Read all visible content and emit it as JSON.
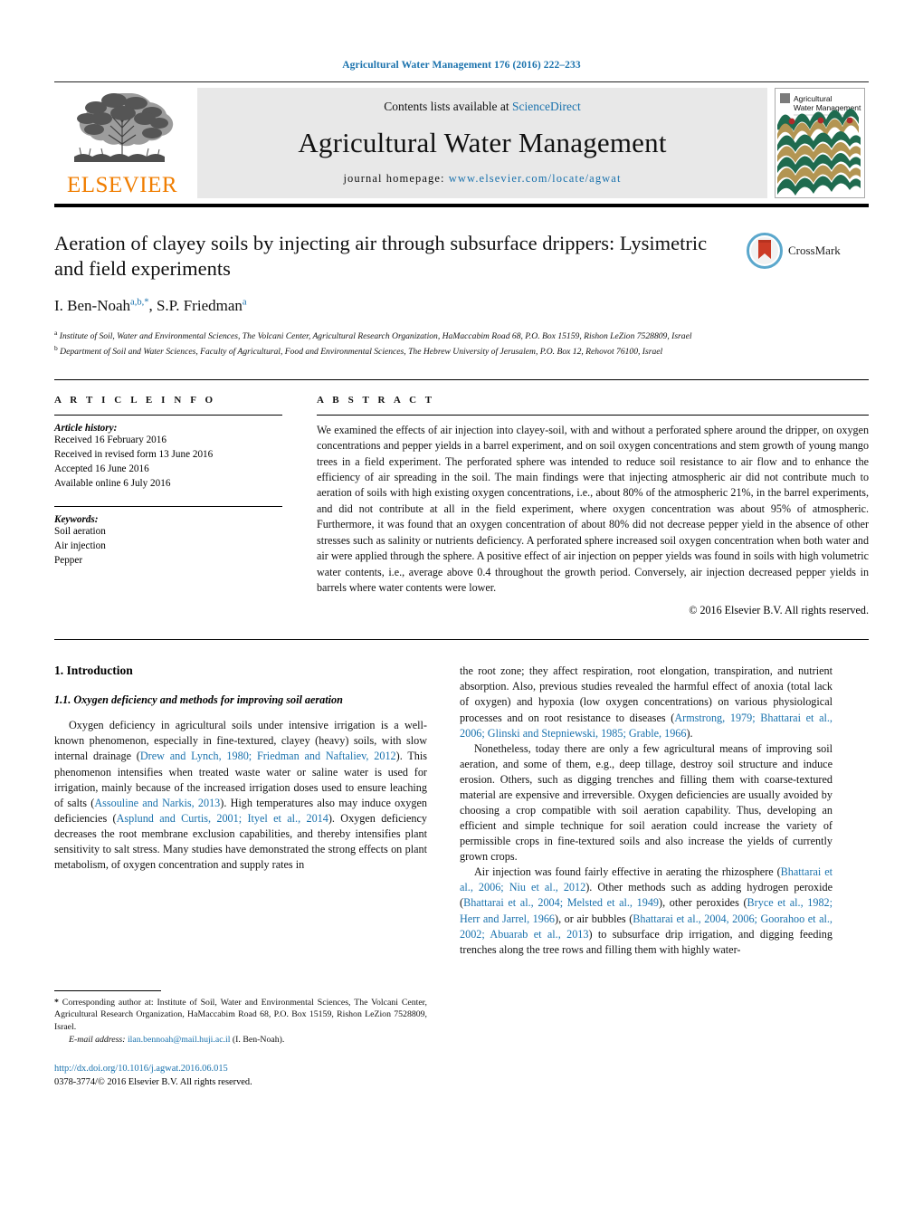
{
  "running_head": "Agricultural Water Management 176 (2016) 222–233",
  "banner": {
    "contents_prefix": "Contents lists available at ",
    "contents_link": "ScienceDirect",
    "journal_name": "Agricultural Water Management",
    "homepage_prefix": "journal homepage: ",
    "homepage_url": "www.elsevier.com/locate/agwat",
    "publisher": "ELSEVIER",
    "cover_title_line1": "Agricultural",
    "cover_title_line2": "Water Management"
  },
  "article": {
    "title": "Aeration of clayey soils by injecting air through subsurface drippers: Lysimetric and field experiments",
    "authors": [
      {
        "name": "I. Ben-Noah",
        "markers": "a,b,*"
      },
      {
        "name": "S.P. Friedman",
        "markers": "a"
      }
    ],
    "crossmark_label": "CrossMark",
    "affiliations": [
      {
        "marker": "a",
        "text": "Institute of Soil, Water and Environmental Sciences, The Volcani Center, Agricultural Research Organization, HaMaccabim Road 68, P.O. Box 15159, Rishon LeZion 7528809, Israel"
      },
      {
        "marker": "b",
        "text": "Department of Soil and Water Sciences, Faculty of Agricultural, Food and Environmental Sciences, The Hebrew University of Jerusalem, P.O. Box 12, Rehovot 76100, Israel"
      }
    ]
  },
  "article_info": {
    "heading": "A R T I C L E  I N F O",
    "history_label": "Article history:",
    "history": [
      "Received 16 February 2016",
      "Received in revised form 13 June 2016",
      "Accepted 16 June 2016",
      "Available online 6 July 2016"
    ],
    "keywords_label": "Keywords:",
    "keywords": [
      "Soil aeration",
      "Air injection",
      "Pepper"
    ]
  },
  "abstract": {
    "heading": "A B S T R A C T",
    "text": "We examined the effects of air injection into clayey-soil, with and without a perforated sphere around the dripper, on oxygen concentrations and pepper yields in a barrel experiment, and on soil oxygen concentrations and stem growth of young mango trees in a field experiment. The perforated sphere was intended to reduce soil resistance to air flow and to enhance the efficiency of air spreading in the soil. The main findings were that injecting atmospheric air did not contribute much to aeration of soils with high existing oxygen concentrations, i.e., about 80% of the atmospheric 21%, in the barrel experiments, and did not contribute at all in the field experiment, where oxygen concentration was about 95% of atmospheric. Furthermore, it was found that an oxygen concentration of about 80% did not decrease pepper yield in the absence of other stresses such as salinity or nutrients deficiency. A perforated sphere increased soil oxygen concentration when both water and air were applied through the sphere. A positive effect of air injection on pepper yields was found in soils with high volumetric water contents, i.e., average above 0.4 throughout the growth period. Conversely, air injection decreased pepper yields in barrels where water contents were lower.",
    "copyright": "© 2016 Elsevier B.V. All rights reserved."
  },
  "body": {
    "section_number_title": "1.  Introduction",
    "subsection_title": "1.1.  Oxygen deficiency and methods for improving soil aeration",
    "left_paragraph_1_a": "Oxygen deficiency in agricultural soils under intensive irrigation is a well-known phenomenon, especially in fine-textured, clayey (heavy) soils, with slow internal drainage (",
    "left_cite_1": "Drew and Lynch, 1980; Friedman and Naftaliev, 2012",
    "left_paragraph_1_b": "). This phenomenon intensifies when treated waste water or saline water is used for irrigation, mainly because of the increased irrigation doses used to ensure leaching of salts (",
    "left_cite_2": "Assouline and Narkis, 2013",
    "left_paragraph_1_c": "). High temperatures also may induce oxygen deficiencies (",
    "left_cite_3": "Asplund and Curtis, 2001; Ityel et al., 2014",
    "left_paragraph_1_d": "). Oxygen deficiency decreases the root membrane exclusion capabilities, and thereby intensifies plant sensitivity to salt stress. Many studies have demonstrated the strong effects on plant metabolism, of oxygen concentration and supply rates in",
    "right_paragraph_1_a": "the root zone; they affect respiration, root elongation, transpiration, and nutrient absorption. Also, previous studies revealed the harmful effect of anoxia (total lack of oxygen) and hypoxia (low oxygen concentrations) on various physiological processes and on root resistance to diseases (",
    "right_cite_1": "Armstrong, 1979; Bhattarai et al., 2006; Glinski and Stepniewski, 1985; Grable, 1966",
    "right_paragraph_1_b": ").",
    "right_paragraph_2": "Nonetheless, today there are only a few agricultural means of improving soil aeration, and some of them, e.g., deep tillage, destroy soil structure and induce erosion. Others, such as digging trenches and filling them with coarse-textured material are expensive and irreversible. Oxygen deficiencies are usually avoided by choosing a crop compatible with soil aeration capability. Thus, developing an efficient and simple technique for soil aeration could increase the variety of permissible crops in fine-textured soils and also increase the yields of currently grown crops.",
    "right_paragraph_3_a": "Air injection was found fairly effective in aerating the rhizosphere (",
    "right_cite_2": "Bhattarai et al., 2006; Niu et al., 2012",
    "right_paragraph_3_b": "). Other methods such as adding hydrogen peroxide (",
    "right_cite_3": "Bhattarai et al., 2004; Melsted et al., 1949",
    "right_paragraph_3_c": "), other peroxides (",
    "right_cite_4": "Bryce et al., 1982; Herr and Jarrel, 1966",
    "right_paragraph_3_d": "), or air bubbles (",
    "right_cite_5": "Bhattarai et al., 2004, 2006; Goorahoo et al., 2002; Abuarab et al., 2013",
    "right_paragraph_3_e": ") to subsurface drip irrigation, and digging feeding trenches along the tree rows and filling them with highly water-"
  },
  "footnote": {
    "star": "*",
    "corresponding": " Corresponding author at: Institute of Soil, Water and Environmental Sciences, The Volcani Center, Agricultural Research Organization, HaMaccabim Road 68, P.O. Box 15159, Rishon LeZion 7528809, Israel.",
    "email_label": "E-mail address:",
    "email_address": "ilan.bennoah@mail.huji.ac.il",
    "email_owner": " (I. Ben-Noah).",
    "doi": "http://dx.doi.org/10.1016/j.agwat.2016.06.015",
    "issn_line": "0378-3774/© 2016 Elsevier B.V. All rights reserved."
  },
  "colors": {
    "link": "#1a72ad",
    "elsevier_orange": "#f07d00",
    "banner_bg": "#e8e8e8"
  }
}
